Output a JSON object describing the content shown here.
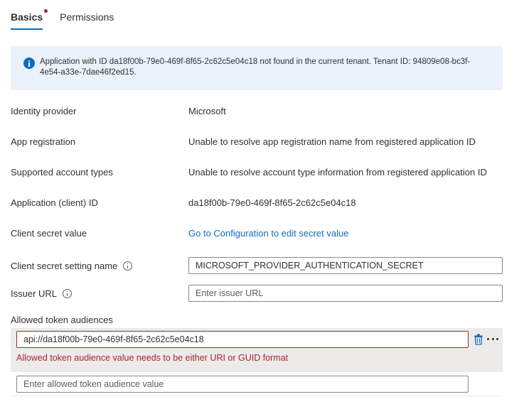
{
  "tabs": [
    {
      "label": "Basics",
      "active": true
    },
    {
      "label": "Permissions",
      "active": false
    }
  ],
  "banner": {
    "text": "Application with ID da18f00b-79e0-469f-8f65-2c62c5e04c18 not found in the current tenant. Tenant ID: 94809e08-bc3f-4e54-a33e-7dae46f2ed15."
  },
  "properties": {
    "identity_provider": {
      "label": "Identity provider",
      "value": "Microsoft"
    },
    "app_registration": {
      "label": "App registration",
      "value": "Unable to resolve app registration name from registered application ID"
    },
    "supported_account_types": {
      "label": "Supported account types",
      "value": "Unable to resolve account type information from registered application ID"
    },
    "client_id": {
      "label": "Application (client) ID",
      "value": "da18f00b-79e0-469f-8f65-2c62c5e04c18"
    },
    "client_secret_value": {
      "label": "Client secret value",
      "link": "Go to Configuration to edit secret value"
    },
    "client_secret_setting_name": {
      "label": "Client secret setting name",
      "value": "MICROSOFT_PROVIDER_AUTHENTICATION_SECRET"
    },
    "issuer_url": {
      "label": "Issuer URL",
      "value": "",
      "placeholder": "Enter issuer URL"
    }
  },
  "audiences": {
    "label": "Allowed token audiences",
    "items": [
      {
        "value": "api://da18f00b-79e0-469f-8f65-2c62c5e04c18",
        "error": "Allowed token audience value needs to be either URI or GUID format"
      }
    ],
    "new_placeholder": "Enter allowed token audience value"
  },
  "colors": {
    "accent": "#0f6cbd",
    "error": "#a4262c",
    "banner_bg": "#eaf2fb"
  }
}
